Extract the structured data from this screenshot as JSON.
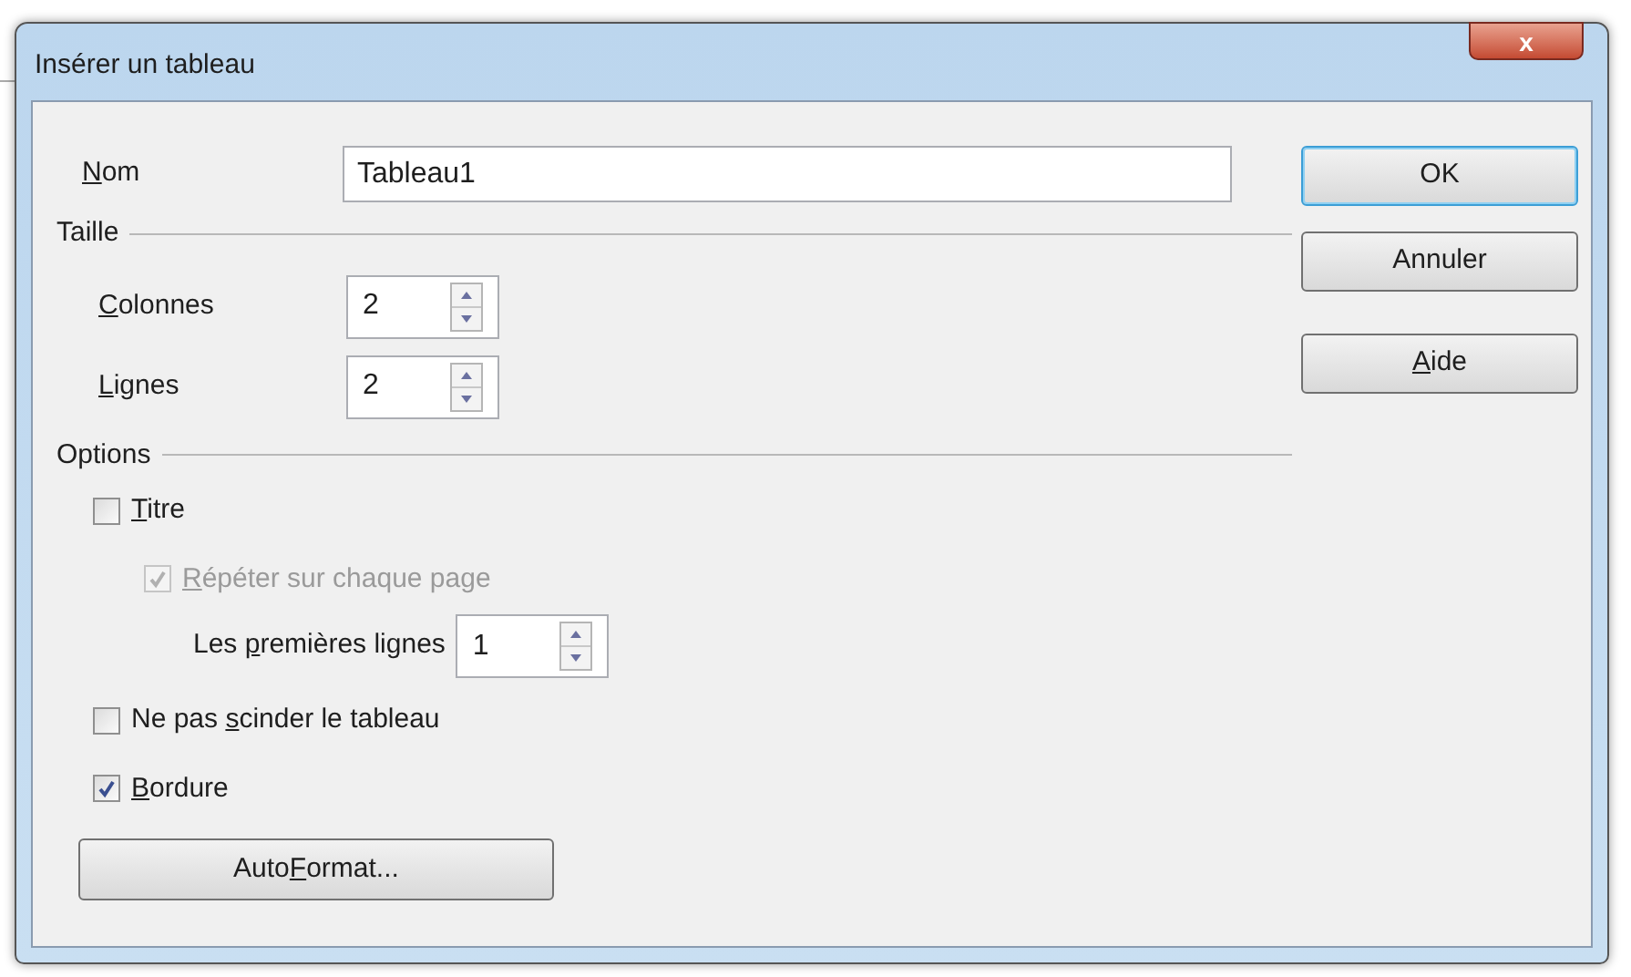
{
  "window": {
    "title": "Insérer un tableau",
    "close": "x"
  },
  "name": {
    "label": {
      "key": "N",
      "after": "om"
    },
    "value": "Tableau1"
  },
  "size": {
    "heading": "Taille",
    "fields": [
      {
        "label": {
          "key": "C",
          "after": "olonnes"
        },
        "value": "2"
      },
      {
        "label": {
          "key": "L",
          "after": "ignes"
        },
        "value": "2"
      }
    ]
  },
  "options": {
    "heading": "Options",
    "items": [
      {
        "kind": "checkbox",
        "label": {
          "key": "T",
          "after": "itre"
        },
        "checked": false,
        "disabled": false
      },
      {
        "kind": "checkbox",
        "label": {
          "key": "R",
          "after": "épéter sur chaque page"
        },
        "checked": true,
        "disabled": true
      },
      {
        "kind": "spin",
        "label": {
          "before": "Les ",
          "key": "p",
          "after": "remières lignes"
        },
        "value": "1"
      },
      {
        "kind": "checkbox",
        "label": {
          "before": "Ne pas ",
          "key": "s",
          "after": "cinder le tableau"
        },
        "checked": false,
        "disabled": false
      },
      {
        "kind": "checkbox",
        "label": {
          "key": "B",
          "after": "ordure"
        },
        "checked": true,
        "disabled": false
      }
    ],
    "button": {
      "label": {
        "before": "Auto",
        "key": "F",
        "after": "ormat..."
      }
    }
  },
  "buttons": [
    {
      "label": {
        "before": "OK"
      },
      "default": true
    },
    {
      "label": {
        "before": "Annuler"
      },
      "default": false
    },
    {
      "label": {
        "key": "A",
        "after": "ide"
      },
      "default": false
    }
  ]
}
